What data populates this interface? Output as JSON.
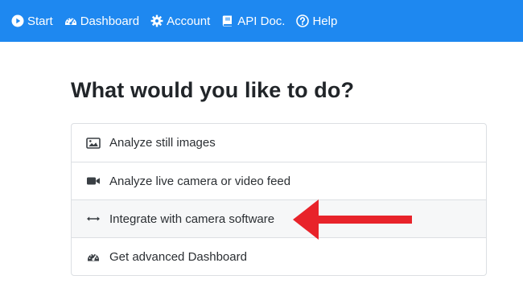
{
  "navbar": {
    "items": [
      {
        "label": "Start",
        "icon": "play-circle-icon"
      },
      {
        "label": "Dashboard",
        "icon": "tachometer-icon"
      },
      {
        "label": "Account",
        "icon": "gear-icon"
      },
      {
        "label": "API Doc.",
        "icon": "book-icon"
      },
      {
        "label": "Help",
        "icon": "question-circle-icon"
      }
    ],
    "background": "#1e88f0"
  },
  "main": {
    "heading": "What would you like to do?",
    "options": [
      {
        "label": "Analyze still images",
        "icon": "image-icon"
      },
      {
        "label": "Analyze live camera or video feed",
        "icon": "video-camera-icon"
      },
      {
        "label": "Integrate with camera software",
        "icon": "arrows-horizontal-icon"
      },
      {
        "label": "Get advanced Dashboard",
        "icon": "tachometer-icon"
      }
    ]
  },
  "annotation": {
    "arrow_color": "#e8232a",
    "highlighted_option": "Integrate with camera software"
  }
}
